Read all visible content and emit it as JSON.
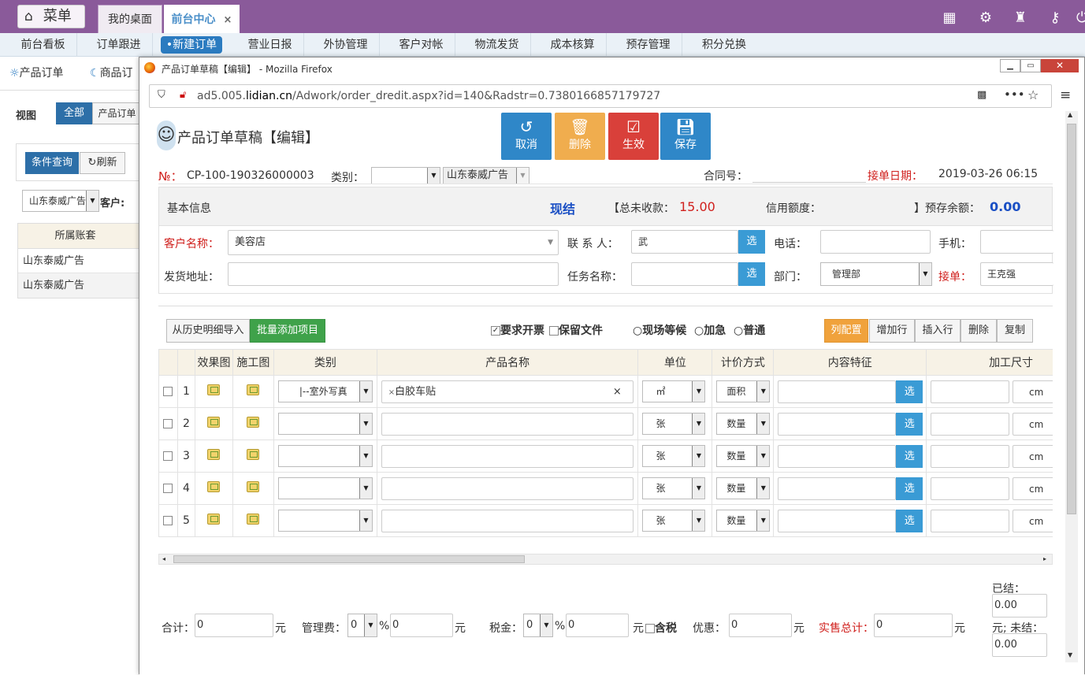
{
  "top": {
    "menu_label": "菜单",
    "tabs": [
      {
        "label": "我的桌面"
      },
      {
        "label": "前台中心",
        "close": "×"
      }
    ]
  },
  "nav": [
    "前台看板",
    "订单跟进",
    "•新建订单",
    "营业日报",
    "外协管理",
    "客户对帐",
    "物流发货",
    "成本核算",
    "预存管理",
    "积分兑换"
  ],
  "left": {
    "tab1": "产品订单",
    "tab2": "商品订",
    "view_label": "视图",
    "view_all": "全部",
    "view_product": "产品订单",
    "query_btn": "条件查询",
    "refresh_btn": "刷新",
    "company_select": "山东泰威广告",
    "customer_label": "客户:",
    "col_header": "所属账套",
    "rows": [
      "山东泰威广告",
      "山东泰威广告"
    ]
  },
  "window": {
    "title": "产品订单草稿【编辑】 - Mozilla Firefox",
    "url_prefix": "ad5.005.",
    "url_domain": "lidian.cn",
    "url_path": "/Adwork/order_dredit.aspx?id=140&Radstr=0.7380166857179727"
  },
  "form": {
    "page_title": "产品订单草稿【编辑】",
    "buttons": {
      "cancel": "取消",
      "delete": "删除",
      "confirm": "生效",
      "save": "保存"
    },
    "no_label": "№：",
    "no_value": "CP-100-190326000003",
    "category_label": "类别：",
    "company": "山东泰威广告",
    "contract_label": "合同号：",
    "date_label": "接单日期：",
    "date_value": "2019-03-26 06:15",
    "info_title": "基本信息",
    "pay_type": "现结",
    "unpaid_label": "【总未收款：",
    "unpaid_value": "15.00",
    "credit_label": "信用额度：",
    "deposit_label": "】预存余额：",
    "deposit_value": "0.00",
    "customer_label": "客户名称：",
    "customer_value": "美容店",
    "contact_label": "联 系 人：",
    "contact_value": "武",
    "pick": "选",
    "phone_label": "电话：",
    "mobile_label": "手机：",
    "address_label": "发货地址：",
    "task_label": "任务名称：",
    "dept_label": "部门：",
    "dept_value": "管理部",
    "taker_label": "接单：",
    "taker_value": "王克强"
  },
  "items": {
    "import_btn": "从历史明细导入",
    "batch_btn": "批量添加项目",
    "invoice_label": "要求开票",
    "keep_file_label": "保留文件",
    "opt1": "现场等候",
    "opt2": "加急",
    "opt3": "普通",
    "col_cfg_btn": "列配置",
    "add_btn": "增加行",
    "insert_btn": "插入行",
    "del_btn": "删除",
    "copy_btn": "复制",
    "headers": [
      "效果图",
      "施工图",
      "类别",
      "产品名称",
      "单位",
      "计价方式",
      "内容特征",
      "加工尺寸"
    ],
    "rows": [
      {
        "no": "1",
        "category": "|--室外写真",
        "product": "白胶车贴",
        "product_x": "×",
        "unit": "㎡",
        "pricing": "面积",
        "size_unit": "cm"
      },
      {
        "no": "2",
        "category": "",
        "product": "",
        "product_x": "",
        "unit": "张",
        "pricing": "数量",
        "size_unit": "cm"
      },
      {
        "no": "3",
        "category": "",
        "product": "",
        "product_x": "",
        "unit": "张",
        "pricing": "数量",
        "size_unit": "cm"
      },
      {
        "no": "4",
        "category": "",
        "product": "",
        "product_x": "",
        "unit": "张",
        "pricing": "数量",
        "size_unit": "cm"
      },
      {
        "no": "5",
        "category": "",
        "product": "",
        "product_x": "",
        "unit": "张",
        "pricing": "数量",
        "size_unit": "cm"
      }
    ]
  },
  "totals": {
    "sum_label": "合计：",
    "sum_value": "0",
    "yuan": "元",
    "mgmt_label": "管理费：",
    "mgmt_pct": "0",
    "mgmt_value": "0",
    "pct": "%",
    "tax_label": "税金：",
    "tax_pct": "0",
    "tax_value": "0",
    "tax_incl": "含税",
    "discount_label": "优惠：",
    "discount_value": "0",
    "sales_label": "实售总计：",
    "sales_value": "0",
    "settled_label": "已结：",
    "settled_value": "0.00",
    "unsettled_label": "元; 未结：",
    "unsettled_value": "0.00"
  },
  "colors": {
    "purple": "#8a5a9a",
    "blue": "#2b7bc0",
    "cancel": "#2f87c8",
    "delete": "#f0ad4e",
    "confirm": "#d9403a",
    "save": "#2f87c8"
  }
}
